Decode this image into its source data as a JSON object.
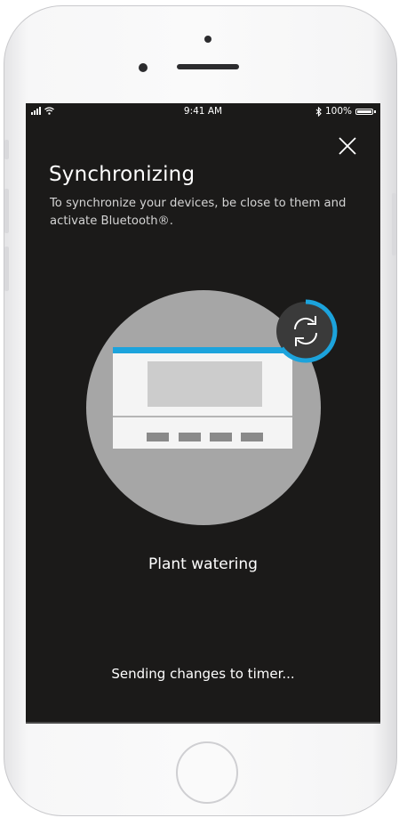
{
  "status_bar": {
    "time": "9:41 AM",
    "battery": "100%",
    "icons": [
      "signal-icon",
      "wifi-icon",
      "bluetooth-icon",
      "battery-icon"
    ]
  },
  "header": {
    "title": "Synchronizing",
    "subtitle": "To synchronize your devices, be close to them and activate Bluetooth®."
  },
  "device": {
    "name": "Plant watering",
    "icon": "timer-device-icon"
  },
  "sync": {
    "status": "Sending changes to timer...",
    "icon": "sync-icon"
  },
  "colors": {
    "screen_background": "#1b1a19",
    "accent": "#1ca3dc",
    "circle": "#a6a6a6",
    "device_panel": "#f4f4f4",
    "display": "#cccccc",
    "keys": "#8a8a8a"
  }
}
